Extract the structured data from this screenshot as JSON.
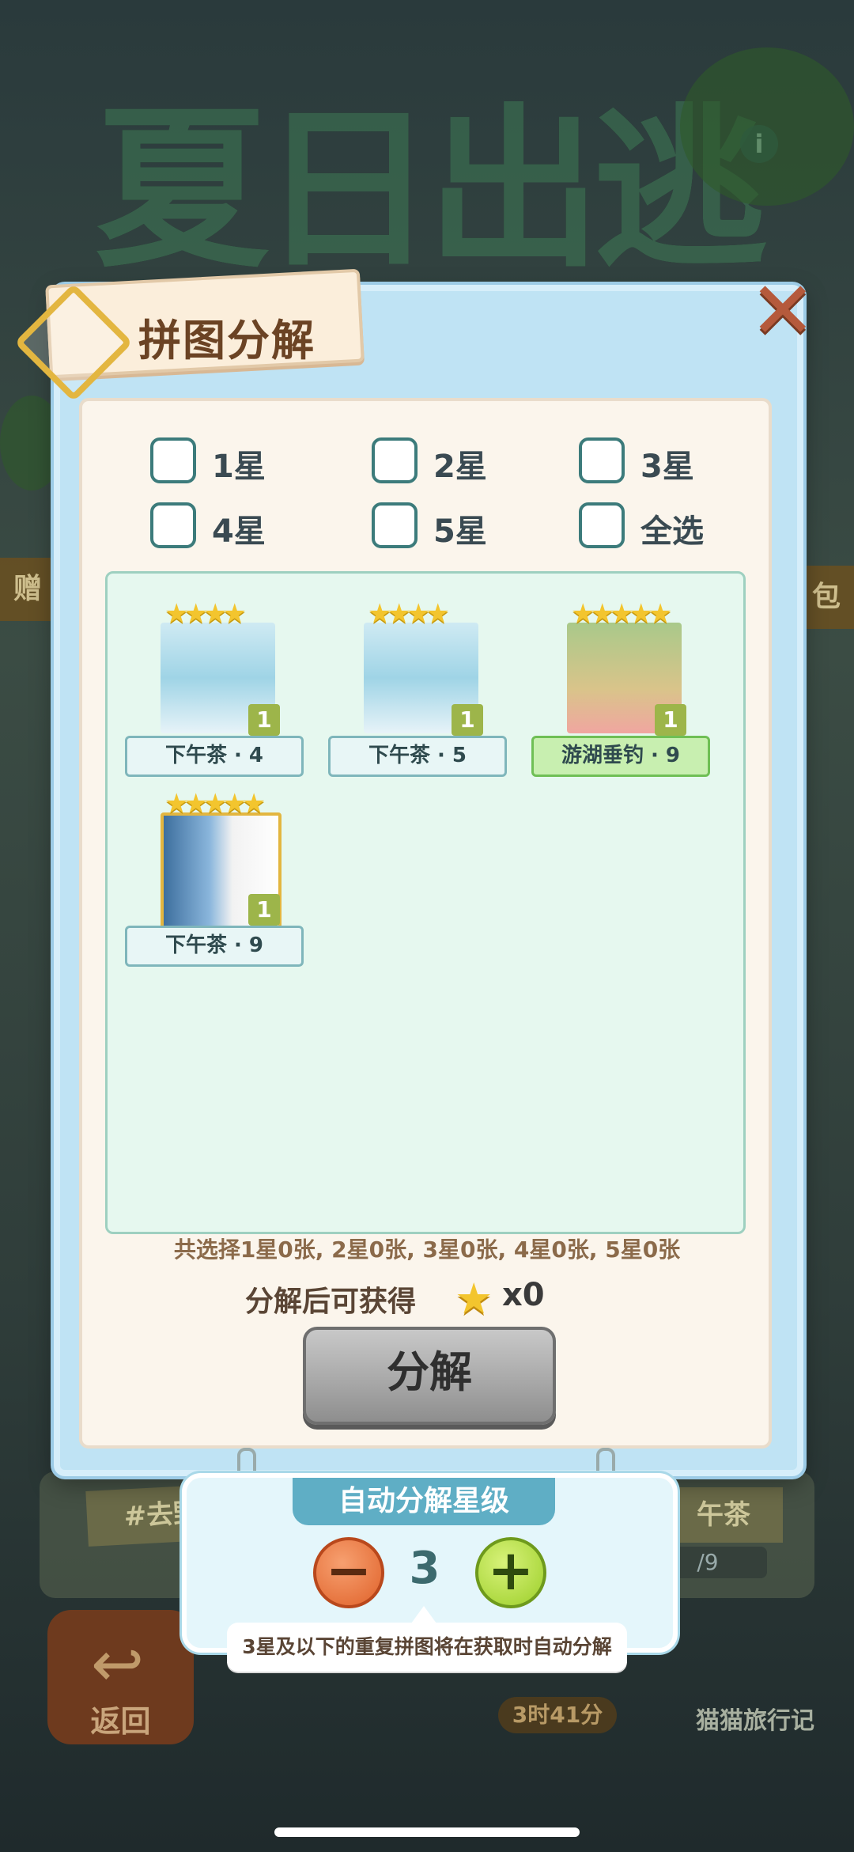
{
  "background": {
    "title": "夏日出逃记",
    "info_icon": "info-icon",
    "left_banner": "赠",
    "right_banner": "包",
    "tag_left": "#去野",
    "tag_right": "午茶",
    "progress": "/9",
    "back_label": "返回",
    "timer": "3时41分",
    "cat_label": "猫猫旅行记"
  },
  "dialog": {
    "title": "拼图分解",
    "close_icon": "close-x-icon"
  },
  "filters": [
    {
      "label": "1星"
    },
    {
      "label": "2星"
    },
    {
      "label": "3星"
    },
    {
      "label": "4星"
    },
    {
      "label": "5星"
    },
    {
      "label": "全选"
    }
  ],
  "pieces": [
    {
      "name": "下午茶 · 4",
      "stars": 4,
      "count": "1",
      "style": "blue"
    },
    {
      "name": "下午茶 · 5",
      "stars": 4,
      "count": "1",
      "style": "blue"
    },
    {
      "name": "游湖垂钓 · 9",
      "stars": 5,
      "count": "1",
      "style": "green"
    },
    {
      "name": "下午茶 · 9",
      "stars": 5,
      "count": "1",
      "style": "white"
    }
  ],
  "summary": "共选择1星0张, 2星0张, 3星0张, 4星0张, 5星0张",
  "reward": {
    "label": "分解后可获得",
    "icon": "star-icon",
    "value": "x0"
  },
  "decompose_button": "分解",
  "auto": {
    "title": "自动分解星级",
    "level": "3",
    "minus_icon": "minus-icon",
    "plus_icon": "plus-icon",
    "hint": "3星及以下的重复拼图将在获取时自动分解"
  },
  "colors": {
    "accent_blue": "#5faec5",
    "dialog_bg": "#bfe3f4",
    "star": "#f3c52e"
  }
}
